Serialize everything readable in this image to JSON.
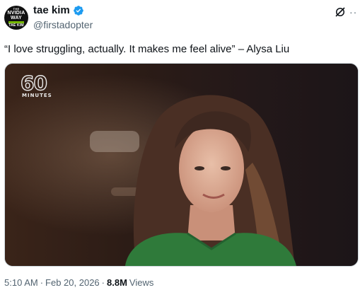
{
  "author": {
    "display_name": "tae kim",
    "handle": "@firstadopter",
    "verified": true,
    "avatar_text": [
      "THE",
      "NVIDIA",
      "WAY",
      "TAE KIM"
    ]
  },
  "tweet": {
    "text": "“I love struggling, actually. It makes me feel alive” – Alysa Liu"
  },
  "media": {
    "watermark": "60",
    "watermark_sub": "MINUTES"
  },
  "meta": {
    "time": "5:10 AM",
    "separator": "·",
    "date": "Feb 20, 2026",
    "views_count": "8.8M",
    "views_label": "Views"
  },
  "icons": {
    "verified": "verified-badge-icon",
    "grok": "grok-icon",
    "more": "more-icon"
  },
  "colors": {
    "verified_blue": "#1d9bf0",
    "secondary_text": "#536471",
    "primary_text": "#0f1419",
    "nvidia_green": "#76b900"
  }
}
